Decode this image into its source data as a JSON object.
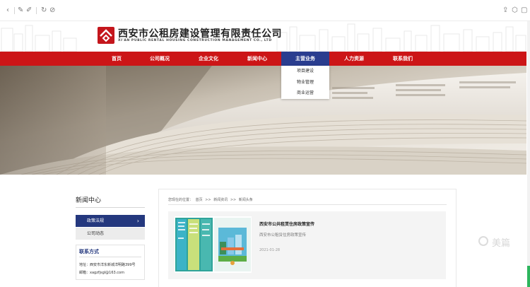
{
  "browser": {
    "icons_left": [
      "back-icon",
      "edit-icon",
      "paint-icon",
      "refresh-icon",
      "stop-icon"
    ],
    "icons_right": [
      "share-icon",
      "extensions-icon",
      "menu-icon"
    ]
  },
  "header": {
    "company_name": "西安市公租房建设管理有限责任公司",
    "company_name_en": "XI'AN PUBLIC RENTAL HOUSING CONSTRUCTION MANAGEMENT CO., LTD",
    "brand_color": "#cc1517"
  },
  "nav": {
    "items": [
      {
        "label": "首页"
      },
      {
        "label": "公司概况"
      },
      {
        "label": "企业文化"
      },
      {
        "label": "新闻中心"
      },
      {
        "label": "主营业务"
      },
      {
        "label": "人力资源"
      },
      {
        "label": "联系我们"
      }
    ],
    "active_index": 4,
    "active_color": "#2a3d8f",
    "dropdown": [
      "项目建设",
      "物业管理",
      "商业运营"
    ]
  },
  "sidebar": {
    "title": "新闻中心",
    "items": [
      {
        "label": "政策法规",
        "active": true
      },
      {
        "label": "公司动态",
        "active": false
      }
    ],
    "contact": {
      "title": "联系方式",
      "address": "地址：西安市洋东新城洋明路399号",
      "email": "邮箱：xagzfjsgl@163.com"
    }
  },
  "main": {
    "breadcrumb": {
      "prefix": "您现在的位置：",
      "items": [
        "首页",
        "新闻资讯",
        "新闻头条"
      ],
      "separator": ">>"
    },
    "news": [
      {
        "title": "西安市公共租赁住房政策宣传",
        "description": "西安市公租赁住房政策宣传",
        "date": "2021-01-28"
      }
    ]
  },
  "watermark": {
    "text": "美篇"
  }
}
